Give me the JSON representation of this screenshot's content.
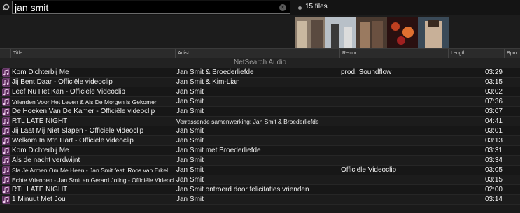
{
  "search": {
    "query": "jan smit",
    "files_count": "15 files"
  },
  "columns": {
    "title": "Title",
    "artist": "Artist",
    "remix": "Remix",
    "length": "Length",
    "bpm": "Bpm"
  },
  "group_label": "NetSearch Audio",
  "icons": {
    "search": "search-icon",
    "clear": "clear-icon",
    "track": "music-note-icon"
  },
  "tracks": [
    {
      "title": "Kom Dichterbij Me",
      "artist": "Jan Smit & Broederliefde",
      "remix": "prod. Soundflow",
      "length": "03:29"
    },
    {
      "title": "Jij Bent Daar - Officiële videoclip",
      "artist": "Jan Smit & Kim-Lian",
      "remix": "",
      "length": "03:15"
    },
    {
      "title": "Leef Nu Het Kan - Officiele Videoclip",
      "artist": "Jan Smit",
      "remix": "",
      "length": "03:02"
    },
    {
      "title": "Vrienden Voor Het Leven & Als De Morgen is Gekomen",
      "artist": "Jan Smit",
      "remix": "",
      "length": "07:36"
    },
    {
      "title": "De Hoeken Van De Kamer - Officiële videoclip",
      "artist": "Jan Smit",
      "remix": "",
      "length": "03:07"
    },
    {
      "title": "RTL LATE NIGHT",
      "artist": "Verrassende samenwerking: Jan Smit & Broederliefde",
      "remix": "",
      "length": "04:41"
    },
    {
      "title": "Jij Laat Mij Niet Slapen - Officiële videoclip",
      "artist": "Jan Smit",
      "remix": "",
      "length": "03:01"
    },
    {
      "title": "Welkom In M'n Hart - Officiële videoclip",
      "artist": "Jan Smit",
      "remix": "",
      "length": "03:13"
    },
    {
      "title": "Kom Dichterbij Me",
      "artist": "Jan Smit met Broederliefde",
      "remix": "",
      "length": "03:31"
    },
    {
      "title": "Als de nacht verdwijnt",
      "artist": "Jan Smit",
      "remix": "",
      "length": "03:34"
    },
    {
      "title": "Sla Je Armen Om Me Heen - Jan Smit feat. Roos van Erkel",
      "artist": "Jan Smit",
      "remix": "Officiële Videoclip",
      "length": "03:05"
    },
    {
      "title": "Echte Vrienden - Jan Smit en Gerard Joling - Officiële Videoclip",
      "artist": "Jan Smit",
      "remix": "",
      "length": "03:15"
    },
    {
      "title": "RTL LATE NIGHT",
      "artist": "Jan Smit ontroerd door felicitaties vrienden",
      "remix": "",
      "length": "02:00"
    },
    {
      "title": "1 Minuut Met Jou",
      "artist": "Jan Smit",
      "remix": "",
      "length": "03:14"
    }
  ]
}
